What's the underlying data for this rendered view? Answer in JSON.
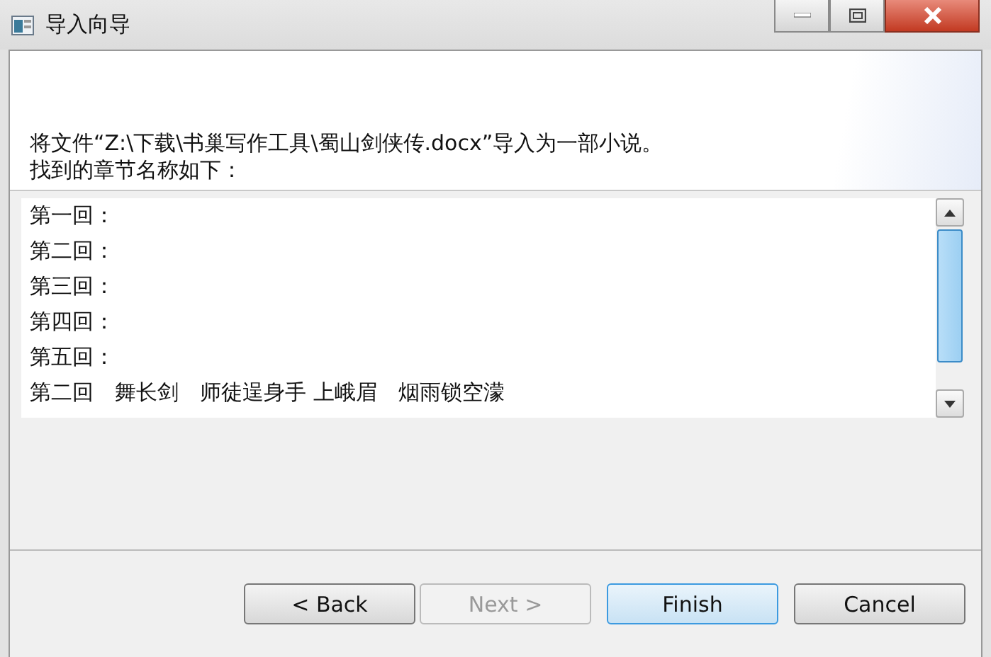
{
  "window": {
    "title": "导入向导"
  },
  "header": {
    "message": "将文件“Z:\\下载\\书巢写作工具\\蜀山剑侠传.docx”导入为一部小说。",
    "prompt": "找到的章节名称如下："
  },
  "chapters": [
    "第一回：",
    "第二回：",
    "第三回：",
    "第四回：",
    "第五回：",
    "第二回　舞长剑　师徒逞身手 上峨眉　烟雨锁空濛"
  ],
  "buttons": [
    {
      "label": "< Back",
      "disabled": false,
      "default": false
    },
    {
      "label": "Next >",
      "disabled": true,
      "default": false
    },
    {
      "label": "Finish",
      "disabled": false,
      "default": true
    },
    {
      "label": "Cancel",
      "disabled": false,
      "default": false
    }
  ]
}
